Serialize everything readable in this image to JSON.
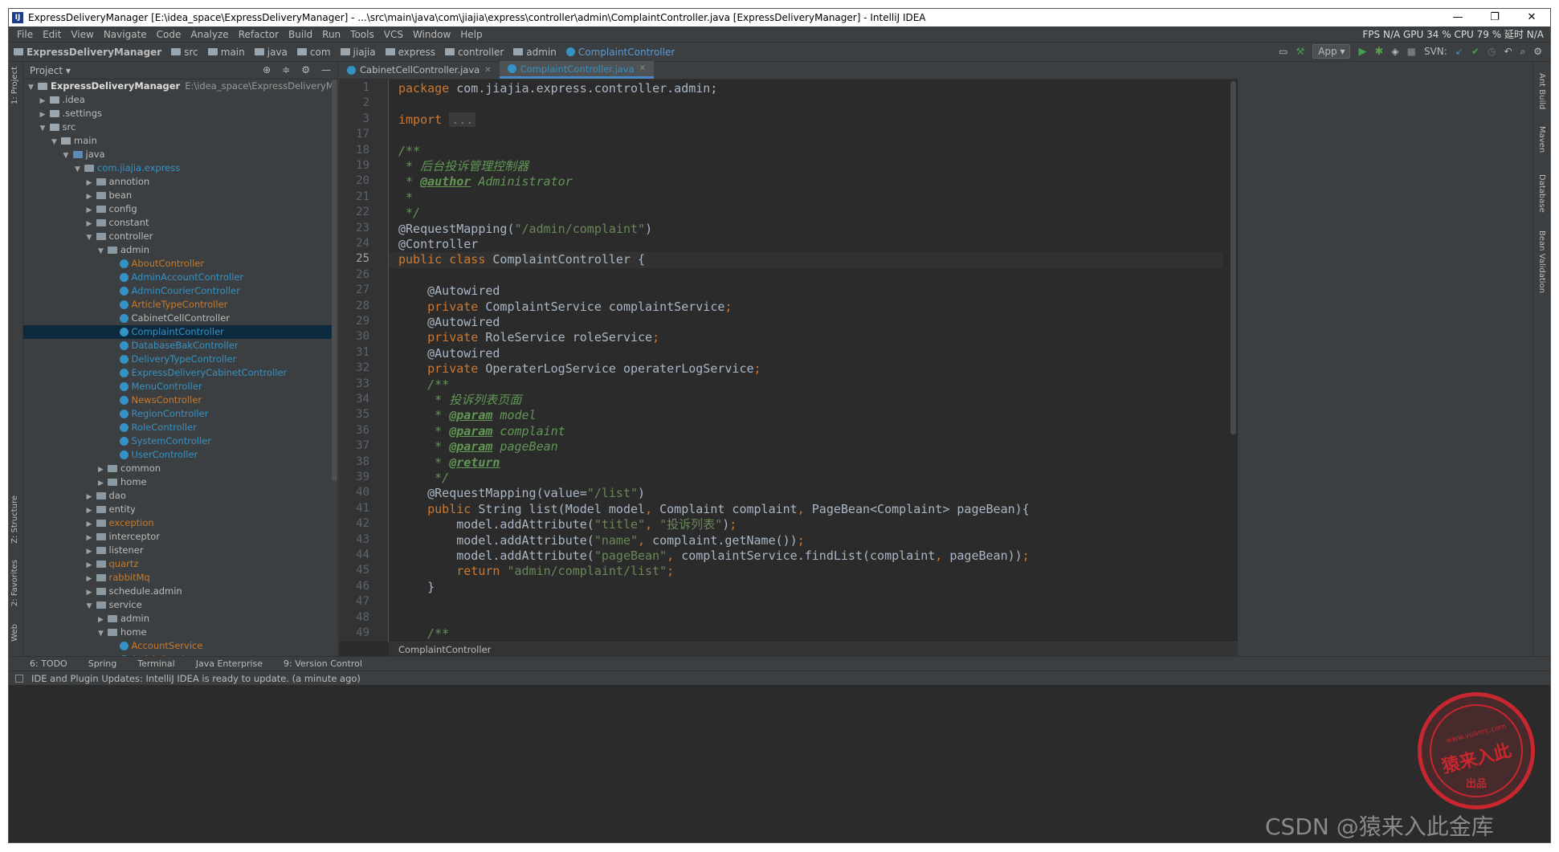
{
  "window": {
    "title": "ExpressDeliveryManager [E:\\idea_space\\ExpressDeliveryManager] - ...\\src\\main\\java\\com\\jiajia\\express\\controller\\admin\\ComplaintController.java [ExpressDeliveryManager] - IntelliJ IDEA",
    "minimize": "—",
    "maximize": "❐",
    "close": "✕"
  },
  "menu": [
    "File",
    "Edit",
    "View",
    "Navigate",
    "Code",
    "Analyze",
    "Refactor",
    "Build",
    "Run",
    "Tools",
    "VCS",
    "Window",
    "Help"
  ],
  "stats": "FPS  N/A  GPU  34 %  CPU  79 %  延时  N/A",
  "breadcrumbs": [
    "ExpressDeliveryManager",
    "src",
    "main",
    "java",
    "com",
    "jiajia",
    "express",
    "controller",
    "admin",
    "ComplaintController"
  ],
  "toolbar": {
    "app_select": "App ▾",
    "svn": "SVN:"
  },
  "project": {
    "title": "Project ▾",
    "root_name": "ExpressDeliveryManager",
    "root_path": "E:\\idea_space\\ExpressDeliveryManager",
    "items": [
      {
        "label": ".idea",
        "indent": 1,
        "arrow": "▶",
        "icon": "folder",
        "color": "normal"
      },
      {
        "label": ".settings",
        "indent": 1,
        "arrow": "▶",
        "icon": "folder",
        "color": "normal"
      },
      {
        "label": "src",
        "indent": 1,
        "arrow": "▼",
        "icon": "folder",
        "color": "normal"
      },
      {
        "label": "main",
        "indent": 2,
        "arrow": "▼",
        "icon": "folder",
        "color": "normal"
      },
      {
        "label": "java",
        "indent": 3,
        "arrow": "▼",
        "icon": "src",
        "color": "normal"
      },
      {
        "label": "com.jiajia.express",
        "indent": 4,
        "arrow": "▼",
        "icon": "pkg",
        "color": "blue"
      },
      {
        "label": "annotion",
        "indent": 5,
        "arrow": "▶",
        "icon": "pkg",
        "color": "normal"
      },
      {
        "label": "bean",
        "indent": 5,
        "arrow": "▶",
        "icon": "pkg",
        "color": "normal"
      },
      {
        "label": "config",
        "indent": 5,
        "arrow": "▶",
        "icon": "pkg",
        "color": "normal"
      },
      {
        "label": "constant",
        "indent": 5,
        "arrow": "▶",
        "icon": "pkg",
        "color": "normal"
      },
      {
        "label": "controller",
        "indent": 5,
        "arrow": "▼",
        "icon": "pkg",
        "color": "normal"
      },
      {
        "label": "admin",
        "indent": 6,
        "arrow": "▼",
        "icon": "pkg",
        "color": "normal"
      },
      {
        "label": "AboutController",
        "indent": 7,
        "arrow": "",
        "icon": "class",
        "color": "orange"
      },
      {
        "label": "AdminAccountController",
        "indent": 7,
        "arrow": "",
        "icon": "class",
        "color": "blue"
      },
      {
        "label": "AdminCourierController",
        "indent": 7,
        "arrow": "",
        "icon": "class",
        "color": "blue"
      },
      {
        "label": "ArticleTypeController",
        "indent": 7,
        "arrow": "",
        "icon": "class",
        "color": "orange"
      },
      {
        "label": "CabinetCellController",
        "indent": 7,
        "arrow": "",
        "icon": "class",
        "color": "normal"
      },
      {
        "label": "ComplaintController",
        "indent": 7,
        "arrow": "",
        "icon": "class",
        "color": "blue",
        "selected": true
      },
      {
        "label": "DatabaseBakController",
        "indent": 7,
        "arrow": "",
        "icon": "class",
        "color": "blue"
      },
      {
        "label": "DeliveryTypeController",
        "indent": 7,
        "arrow": "",
        "icon": "class",
        "color": "blue"
      },
      {
        "label": "ExpressDeliveryCabinetController",
        "indent": 7,
        "arrow": "",
        "icon": "class",
        "color": "blue"
      },
      {
        "label": "MenuController",
        "indent": 7,
        "arrow": "",
        "icon": "class",
        "color": "blue"
      },
      {
        "label": "NewsController",
        "indent": 7,
        "arrow": "",
        "icon": "class",
        "color": "orange"
      },
      {
        "label": "RegionController",
        "indent": 7,
        "arrow": "",
        "icon": "class",
        "color": "blue"
      },
      {
        "label": "RoleController",
        "indent": 7,
        "arrow": "",
        "icon": "class",
        "color": "blue"
      },
      {
        "label": "SystemController",
        "indent": 7,
        "arrow": "",
        "icon": "class",
        "color": "blue"
      },
      {
        "label": "UserController",
        "indent": 7,
        "arrow": "",
        "icon": "class",
        "color": "blue"
      },
      {
        "label": "common",
        "indent": 6,
        "arrow": "▶",
        "icon": "pkg",
        "color": "normal"
      },
      {
        "label": "home",
        "indent": 6,
        "arrow": "▶",
        "icon": "pkg",
        "color": "normal"
      },
      {
        "label": "dao",
        "indent": 5,
        "arrow": "▶",
        "icon": "pkg",
        "color": "normal"
      },
      {
        "label": "entity",
        "indent": 5,
        "arrow": "▶",
        "icon": "pkg",
        "color": "normal"
      },
      {
        "label": "exception",
        "indent": 5,
        "arrow": "▶",
        "icon": "pkg",
        "color": "orange"
      },
      {
        "label": "interceptor",
        "indent": 5,
        "arrow": "▶",
        "icon": "pkg",
        "color": "normal"
      },
      {
        "label": "listener",
        "indent": 5,
        "arrow": "▶",
        "icon": "pkg",
        "color": "normal"
      },
      {
        "label": "quartz",
        "indent": 5,
        "arrow": "▶",
        "icon": "pkg",
        "color": "orange"
      },
      {
        "label": "rabbitMq",
        "indent": 5,
        "arrow": "▶",
        "icon": "pkg",
        "color": "orange"
      },
      {
        "label": "schedule.admin",
        "indent": 5,
        "arrow": "▶",
        "icon": "pkg",
        "color": "normal"
      },
      {
        "label": "service",
        "indent": 5,
        "arrow": "▼",
        "icon": "pkg",
        "color": "normal"
      },
      {
        "label": "admin",
        "indent": 6,
        "arrow": "▶",
        "icon": "pkg",
        "color": "normal"
      },
      {
        "label": "home",
        "indent": 6,
        "arrow": "▼",
        "icon": "pkg",
        "color": "normal"
      },
      {
        "label": "AccountService",
        "indent": 7,
        "arrow": "",
        "icon": "class",
        "color": "orange"
      },
      {
        "label": "ArticleService",
        "indent": 7,
        "arrow": "",
        "icon": "class",
        "color": "orange"
      }
    ]
  },
  "tabs": [
    {
      "label": "CabinetCellController.java",
      "active": false
    },
    {
      "label": "ComplaintController.java",
      "active": true
    }
  ],
  "code": {
    "current_line": "25",
    "lines": [
      {
        "n": "1",
        "html": "<span class=\"k\">package</span> com.jiajia.express.controller.admin;"
      },
      {
        "n": "2",
        "html": ""
      },
      {
        "n": "3",
        "html": "<span class=\"k\">import</span> <span class=\"fold\">...</span>"
      },
      {
        "n": "17",
        "html": ""
      },
      {
        "n": "18",
        "html": "<span class=\"c\">/**</span>"
      },
      {
        "n": "19",
        "html": "<span class=\"c\"> * 后台投诉管理控制器</span>"
      },
      {
        "n": "20",
        "html": "<span class=\"c\"> * </span><span class=\"ctag\">@author</span><span class=\"c\"> Administrator</span>"
      },
      {
        "n": "21",
        "html": "<span class=\"c\"> *</span>"
      },
      {
        "n": "22",
        "html": "<span class=\"c\"> */</span>"
      },
      {
        "n": "23",
        "html": "<span class=\"a2\">@RequestMapping(</span><span class=\"s\">\"/admin/complaint\"</span><span class=\"a2\">)</span>"
      },
      {
        "n": "24",
        "html": "<span class=\"a2\">@Controller</span>"
      },
      {
        "n": "25",
        "html": "<span class=\"k\">public class</span> ComplaintController {"
      },
      {
        "n": "26",
        "html": ""
      },
      {
        "n": "27",
        "html": "    <span class=\"a2\">@Autowired</span>"
      },
      {
        "n": "28",
        "html": "    <span class=\"k\">private</span> ComplaintService complaintService<span class=\"k\">;</span>"
      },
      {
        "n": "29",
        "html": "    <span class=\"a2\">@Autowired</span>"
      },
      {
        "n": "30",
        "html": "    <span class=\"k\">private</span> RoleService roleService<span class=\"k\">;</span>"
      },
      {
        "n": "31",
        "html": "    <span class=\"a2\">@Autowired</span>"
      },
      {
        "n": "32",
        "html": "    <span class=\"k\">private</span> OperaterLogService operaterLogService<span class=\"k\">;</span>"
      },
      {
        "n": "33",
        "html": "    <span class=\"c\">/**</span>"
      },
      {
        "n": "34",
        "html": "<span class=\"c\">     * 投诉列表页面</span>"
      },
      {
        "n": "35",
        "html": "<span class=\"c\">     * </span><span class=\"ctag\">@param</span><span class=\"c\"> model</span>"
      },
      {
        "n": "36",
        "html": "<span class=\"c\">     * </span><span class=\"ctag\">@param</span><span class=\"c\"> complaint</span>"
      },
      {
        "n": "37",
        "html": "<span class=\"c\">     * </span><span class=\"ctag\">@param</span><span class=\"c\"> pageBean</span>"
      },
      {
        "n": "38",
        "html": "<span class=\"c\">     * </span><span class=\"ctag\">@return</span>"
      },
      {
        "n": "39",
        "html": "<span class=\"c\">     */</span>"
      },
      {
        "n": "40",
        "html": "    <span class=\"a2\">@RequestMapping(value=</span><span class=\"s\">\"/list\"</span><span class=\"a2\">)</span>"
      },
      {
        "n": "41",
        "html": "    <span class=\"k\">public</span> String list(Model model<span class=\"k\">,</span> Complaint complaint<span class=\"k\">,</span> PageBean&lt;Complaint&gt; pageBean){"
      },
      {
        "n": "42",
        "html": "        model.addAttribute(<span class=\"s\">\"title\"</span><span class=\"k\">,</span> <span class=\"s\">\"投诉列表\"</span>)<span class=\"k\">;</span>"
      },
      {
        "n": "43",
        "html": "        model.addAttribute(<span class=\"s\">\"name\"</span><span class=\"k\">,</span> complaint.getName())<span class=\"k\">;</span>"
      },
      {
        "n": "44",
        "html": "        model.addAttribute(<span class=\"s\">\"pageBean\"</span><span class=\"k\">,</span> complaintService.findList(complaint<span class=\"k\">,</span> pageBean))<span class=\"k\">;</span>"
      },
      {
        "n": "45",
        "html": "        <span class=\"k\">return</span> <span class=\"s\">\"admin/complaint/list\"</span><span class=\"k\">;</span>"
      },
      {
        "n": "46",
        "html": "    }"
      },
      {
        "n": "47",
        "html": ""
      },
      {
        "n": "48",
        "html": ""
      },
      {
        "n": "49",
        "html": "    <span class=\"c\">/**</span>"
      }
    ]
  },
  "editor_breadcrumb": "ComplaintController",
  "bottom_tools": [
    "6: TODO",
    "Spring",
    "Terminal",
    "Java Enterprise",
    "9: Version Control"
  ],
  "status": "IDE and Plugin Updates: IntelliJ IDEA is ready to update. (a minute ago)",
  "side_left": [
    "1: Project",
    "Z: Structure",
    "2: Favorites",
    "Web"
  ],
  "side_right": [
    "Ant Build",
    "Maven",
    "Database",
    "Bean Validation"
  ],
  "watermark": {
    "seal_text": "猿来入此",
    "seal_sub": "出品",
    "seal_url": "www.yuanrc.com",
    "csdn": "CSDN @猿来入此金库"
  }
}
